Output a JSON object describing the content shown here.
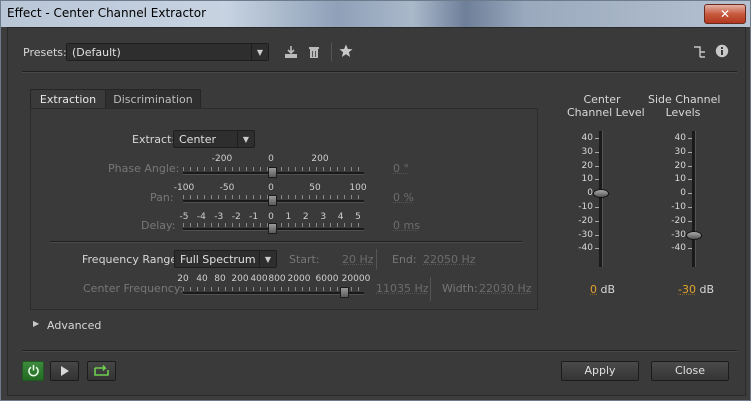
{
  "window": {
    "title": "Effect - Center Channel Extractor",
    "close_glyph": "✕"
  },
  "presets": {
    "label": "Presets:",
    "value": "(Default)"
  },
  "tabs": [
    {
      "label": "Extraction"
    },
    {
      "label": "Discrimination"
    }
  ],
  "extract": {
    "label": "Extract:",
    "value": "Center"
  },
  "phase_angle": {
    "label": "Phase Angle:",
    "ticks": [
      "-200",
      "0",
      "200"
    ],
    "value": "0 °"
  },
  "pan": {
    "label": "Pan:",
    "ticks": [
      "-100",
      "-50",
      "0",
      "50",
      "100"
    ],
    "value": "0 %"
  },
  "delay": {
    "label": "Delay:",
    "ticks": [
      "-5",
      "-4",
      "-3",
      "-2",
      "-1",
      "0",
      "1",
      "2",
      "3",
      "4",
      "5"
    ],
    "value": "0 ms"
  },
  "frequency_range": {
    "label": "Frequency Range:",
    "value": "Full Spectrum",
    "start_label": "Start:",
    "start_value": "20 Hz",
    "end_label": "End:",
    "end_value": "22050 Hz"
  },
  "center_frequency": {
    "label": "Center Frequency:",
    "ticks": [
      "20",
      "40",
      "80",
      "200",
      "400",
      "800",
      "2000",
      "6000",
      "20000"
    ],
    "value": "11035 Hz",
    "width_label": "Width:",
    "width_value": "22030 Hz"
  },
  "advanced": {
    "label": "Advanced"
  },
  "meters": {
    "scale": [
      "40",
      "30",
      "20",
      "10",
      "0",
      "-10",
      "-20",
      "-30",
      "-40"
    ],
    "center": {
      "title_line1": "Center",
      "title_line2": "Channel Level",
      "value": "0",
      "unit": "dB",
      "level_db": 0
    },
    "side": {
      "title_line1": "Side Channel",
      "title_line2": "Levels",
      "value": "-30",
      "unit": "dB",
      "level_db": -30
    }
  },
  "footer": {
    "apply": "Apply",
    "close": "Close"
  },
  "colors": {
    "accent": "#e2a32e",
    "power_green": "#3fa83f"
  }
}
